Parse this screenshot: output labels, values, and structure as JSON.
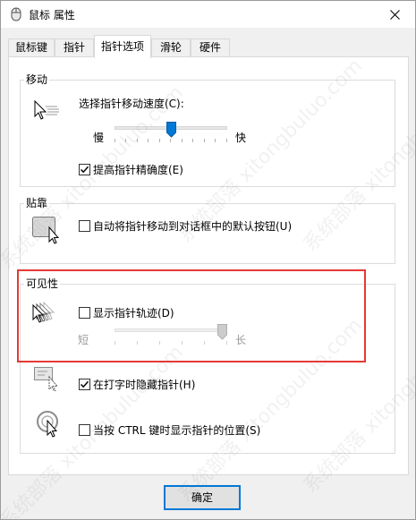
{
  "window": {
    "title": "鼠标 属性",
    "app_icon": "mouse-icon",
    "close_icon": "close-icon"
  },
  "tabs": [
    {
      "label": "鼠标键",
      "active": false
    },
    {
      "label": "指针",
      "active": false
    },
    {
      "label": "指针选项",
      "active": true
    },
    {
      "label": "滑轮",
      "active": false
    },
    {
      "label": "硬件",
      "active": false
    }
  ],
  "motion": {
    "title": "移动",
    "speed_label": "选择指针移动速度(C):",
    "slow_label": "慢",
    "fast_label": "快",
    "speed_level": 0.5,
    "enhance_precision_label": "提高指针精确度(E)",
    "enhance_precision_checked": true
  },
  "snap_to": {
    "title": "贴靠",
    "checkbox_label": "自动将指针移动到对话框中的默认按钮(U)",
    "checked": false
  },
  "visibility": {
    "title": "可见性",
    "trails_label": "显示指针轨迹(D)",
    "trails_checked": false,
    "short_label": "短",
    "long_label": "长",
    "trails_level": 1.0,
    "hide_typing_label": "在打字时隐藏指针(H)",
    "hide_typing_checked": true,
    "show_location_label": "当按 CTRL 键时显示指针的位置(S)",
    "show_location_checked": false
  },
  "buttons": {
    "ok_label": "确定"
  },
  "watermark_text": "系统部落 xitongbuluo.com",
  "colors": {
    "highlight_box": "#e53935",
    "slider_thumb": "#0078d7",
    "accent_border": "#0078d7"
  }
}
